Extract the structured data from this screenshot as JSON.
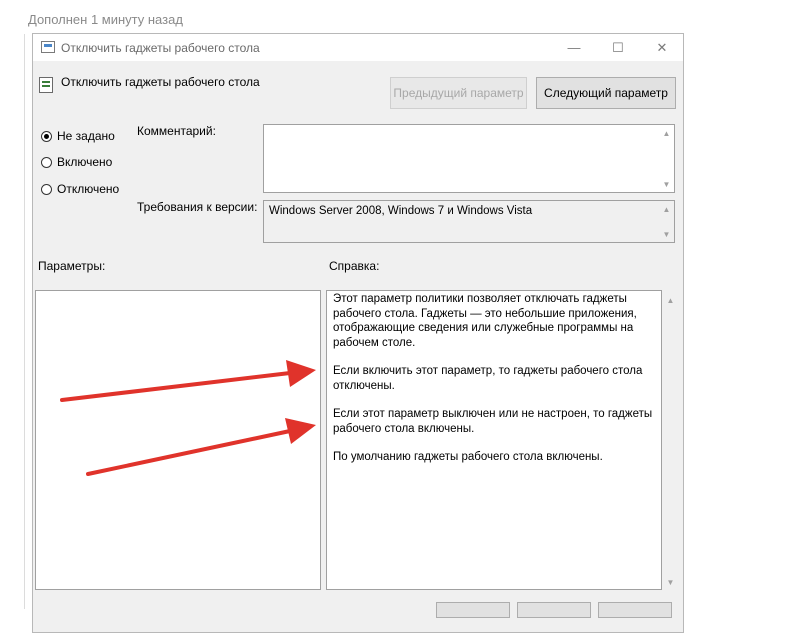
{
  "page": {
    "caption": "Дополнен 1 минуту назад"
  },
  "window": {
    "title": "Отключить гаджеты рабочего стола",
    "controls": {
      "minimize": "—",
      "maximize": "☐",
      "close": "✕"
    }
  },
  "policy": {
    "name": "Отключить гаджеты рабочего стола"
  },
  "buttons": {
    "previous": "Предыдущий параметр",
    "next": "Следующий параметр"
  },
  "state": {
    "options": [
      {
        "label": "Не задано",
        "selected": true
      },
      {
        "label": "Включено",
        "selected": false
      },
      {
        "label": "Отключено",
        "selected": false
      }
    ]
  },
  "comment": {
    "label": "Комментарий:",
    "value": ""
  },
  "supported": {
    "label": "Требования к версии:",
    "value": "Windows Server 2008, Windows 7 и Windows Vista"
  },
  "options_section": {
    "label": "Параметры:"
  },
  "help_section": {
    "label": "Справка:",
    "paragraphs": [
      "Этот параметр политики позволяет отключать гаджеты рабочего стола. Гаджеты — это небольшие приложения, отображающие сведения или служебные программы на рабочем столе.",
      "Если включить этот параметр, то гаджеты рабочего стола отключены.",
      "Если этот параметр выключен или не настроен, то гаджеты рабочего стола включены.",
      "По умолчанию гаджеты рабочего стола включены."
    ]
  },
  "annotations": {
    "arrow_color": "#e0332b"
  },
  "icons": {
    "app": "policy-window-icon",
    "policy": "policy-setting-icon",
    "scroll_up": "chevron-up-icon",
    "scroll_down": "chevron-down-icon"
  }
}
